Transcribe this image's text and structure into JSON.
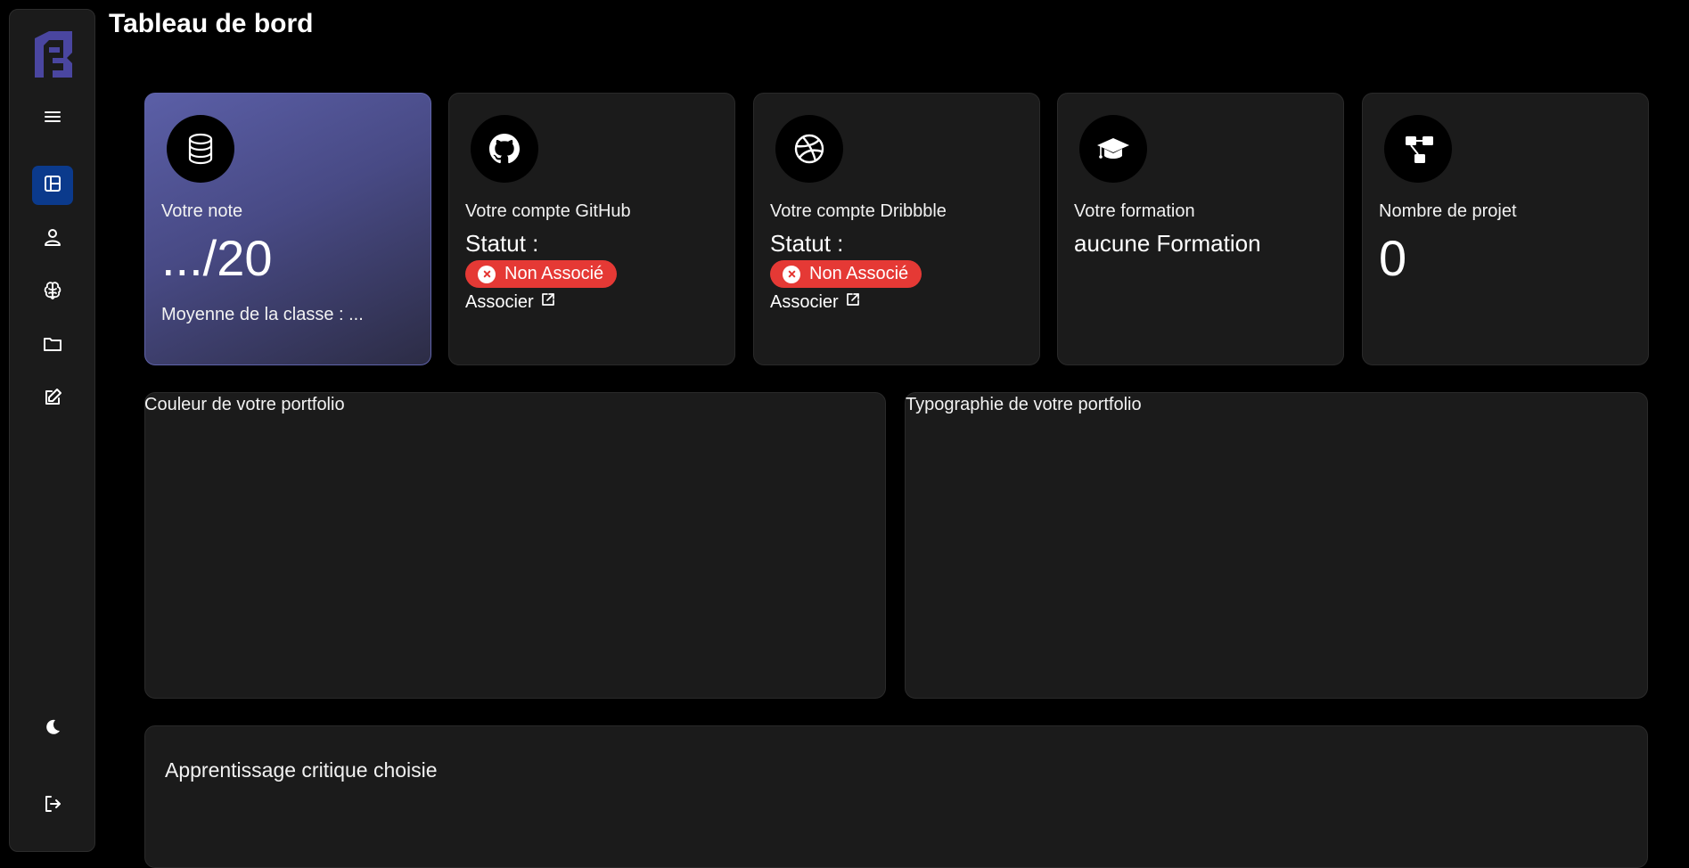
{
  "page": {
    "title": "Tableau de bord"
  },
  "sidebar": {
    "logo": "app-logo",
    "items": [
      {
        "icon": "menu-icon",
        "active": false
      },
      {
        "icon": "dashboard-icon",
        "active": true
      },
      {
        "icon": "user-icon",
        "active": false
      },
      {
        "icon": "brain-icon",
        "active": false
      },
      {
        "icon": "folder-icon",
        "active": false
      },
      {
        "icon": "edit-icon",
        "active": false
      },
      {
        "icon": "moon-icon",
        "active": false
      },
      {
        "icon": "logout-icon",
        "active": false
      }
    ],
    "active_color": "#0b3a8c"
  },
  "cards": {
    "note": {
      "label": "Votre note",
      "value": ".../20",
      "sub": "Moyenne de la classe : ...",
      "icon": "database-icon"
    },
    "github": {
      "label": "Votre compte GitHub",
      "status_label": "Statut :",
      "badge": "Non Associé",
      "link": "Associer",
      "icon": "github-icon"
    },
    "dribbble": {
      "label": "Votre compte Dribbble",
      "status_label": "Statut :",
      "badge": "Non Associé",
      "link": "Associer",
      "icon": "dribbble-icon"
    },
    "formation": {
      "label": "Votre formation",
      "value": "aucune Formation",
      "icon": "graduation-cap-icon"
    },
    "projets": {
      "label": "Nombre de projet",
      "value": "0",
      "icon": "project-tree-icon"
    }
  },
  "panels": {
    "couleur": {
      "title": "Couleur de votre portfolio"
    },
    "typographie": {
      "title": "Typographie de votre portfolio"
    },
    "apprentissage": {
      "title": "Apprentissage critique choisie"
    }
  },
  "colors": {
    "background": "#000000",
    "card": "#1b1b1b",
    "badge_red": "#e53935",
    "note_gradient_start": "#5b5fa7",
    "logo": "#4a46a0"
  }
}
